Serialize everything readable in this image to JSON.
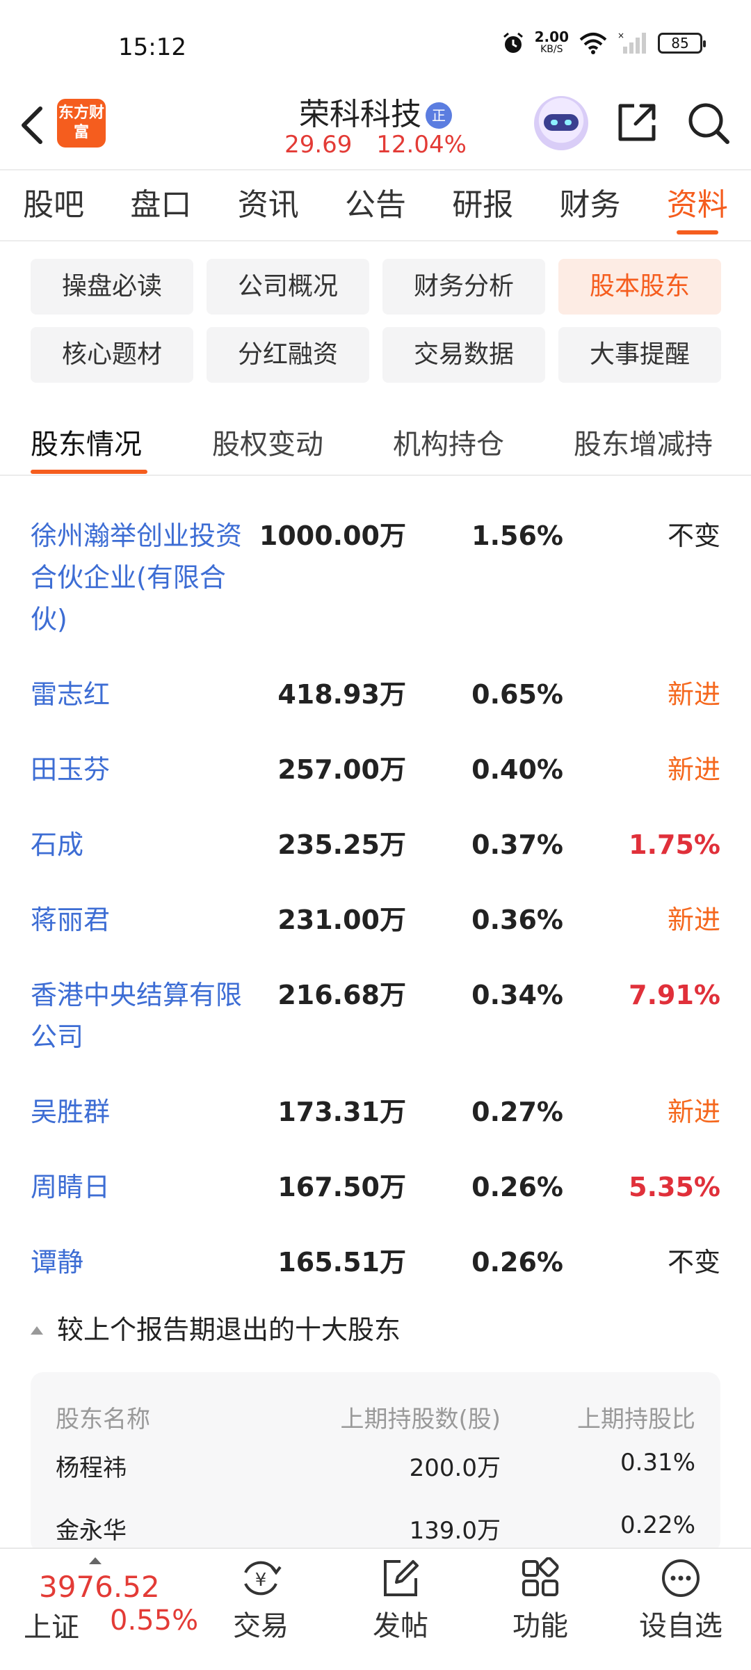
{
  "status_bar": {
    "time": "15:12",
    "speed_value": "2.00",
    "speed_unit": "KB/S",
    "battery": "85"
  },
  "header": {
    "brand_logo": "东方财富",
    "stock_name": "荣科科技",
    "stock_badge": "正",
    "price": "29.69",
    "change_pct": "12.04%"
  },
  "main_tabs": [
    "股吧",
    "盘口",
    "资讯",
    "公告",
    "研报",
    "财务",
    "资料"
  ],
  "main_tab_active": "资料",
  "sub_tabs": [
    "操盘必读",
    "公司概况",
    "财务分析",
    "股本股东",
    "核心题材",
    "分红融资",
    "交易数据",
    "大事提醒"
  ],
  "sub_tab_active": "股本股东",
  "section_tabs": [
    "股东情况",
    "股权变动",
    "机构持仓",
    "股东增减持"
  ],
  "section_tab_active": "股东情况",
  "holders": [
    {
      "name": "徐州瀚举创业投资合伙企业(有限合伙)",
      "shares": "1000.00万",
      "ratio": "1.56%",
      "change": "不变",
      "change_color": "#222222"
    },
    {
      "name": "雷志红",
      "shares": "418.93万",
      "ratio": "0.65%",
      "change": "新进",
      "change_color": "#f5681e"
    },
    {
      "name": "田玉芬",
      "shares": "257.00万",
      "ratio": "0.40%",
      "change": "新进",
      "change_color": "#f5681e"
    },
    {
      "name": "石成",
      "shares": "235.25万",
      "ratio": "0.37%",
      "change": "1.75%",
      "change_color": "#e0303a"
    },
    {
      "name": "蒋丽君",
      "shares": "231.00万",
      "ratio": "0.36%",
      "change": "新进",
      "change_color": "#f5681e"
    },
    {
      "name": "香港中央结算有限公司",
      "shares": "216.68万",
      "ratio": "0.34%",
      "change": "7.91%",
      "change_color": "#e0303a"
    },
    {
      "name": "吴胜群",
      "shares": "173.31万",
      "ratio": "0.27%",
      "change": "新进",
      "change_color": "#f5681e"
    },
    {
      "name": "周睛日",
      "shares": "167.50万",
      "ratio": "0.26%",
      "change": "5.35%",
      "change_color": "#e0303a"
    },
    {
      "name": "谭静",
      "shares": "165.51万",
      "ratio": "0.26%",
      "change": "不变",
      "change_color": "#222222"
    }
  ],
  "exit_section": {
    "title": "较上个报告期退出的十大股东",
    "headers": [
      "股东名称",
      "上期持股数(股)",
      "上期持股比"
    ],
    "rows": [
      {
        "name": "杨程祎",
        "shares": "200.0万",
        "ratio": "0.31%"
      },
      {
        "name": "金永华",
        "shares": "139.0万",
        "ratio": "0.22%"
      }
    ]
  },
  "bottom_bar": {
    "index_value": "3976.52",
    "index_name": "上证",
    "index_change": "0.55%",
    "nav": [
      {
        "label": "交易",
        "icon": "trade-yen-icon"
      },
      {
        "label": "发帖",
        "icon": "compose-post-icon"
      },
      {
        "label": "功能",
        "icon": "function-grid-icon"
      },
      {
        "label": "设自选",
        "icon": "more-dots-icon"
      }
    ]
  },
  "colors": {
    "accent": "#f55d1e",
    "price_up": "#e33b36",
    "holder_link": "#3d6dd4"
  }
}
